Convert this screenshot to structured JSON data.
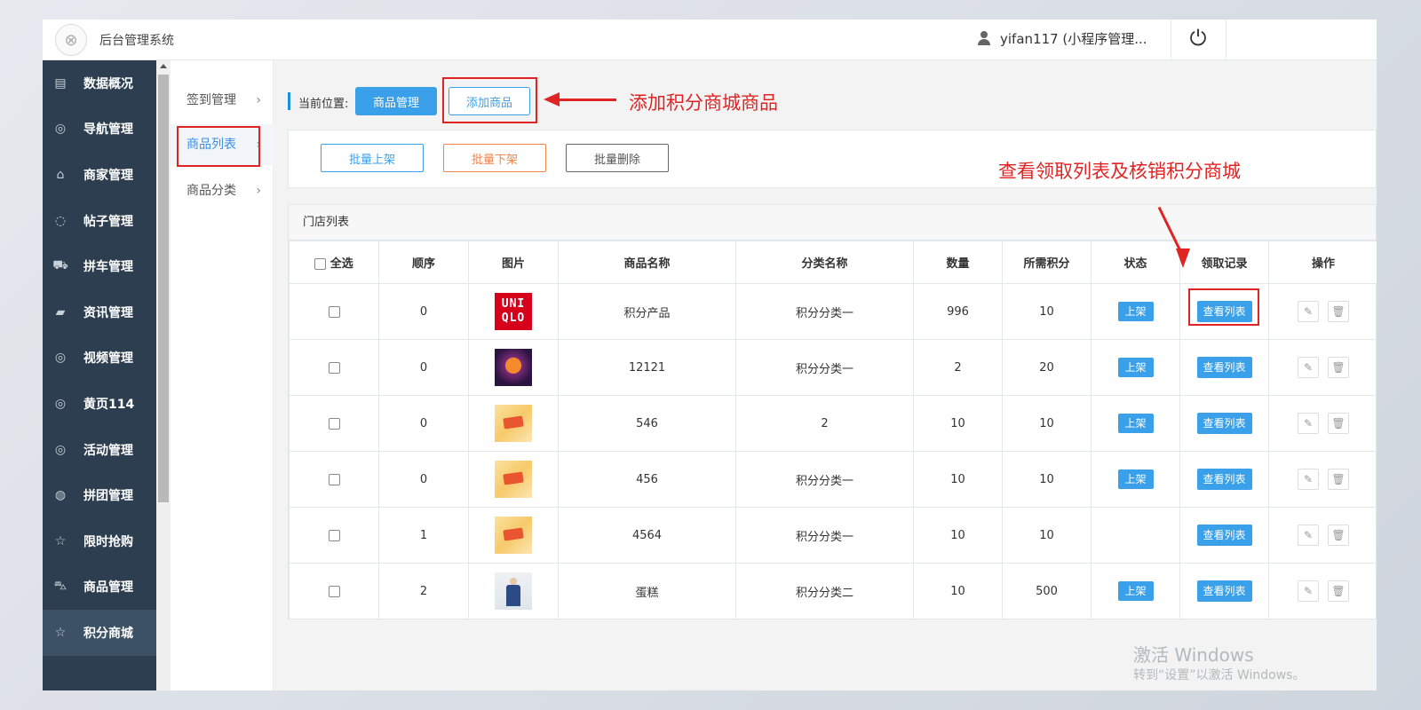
{
  "header": {
    "logo_glyph": "⊗",
    "app_title": "后台管理系统",
    "user_name": "yifan117 (小程序管理...",
    "power_glyph": "⏻"
  },
  "sidebar": {
    "items": [
      {
        "icon": "dashboard-icon",
        "glyph": "▤",
        "label": "数据概况"
      },
      {
        "icon": "compass-icon",
        "glyph": "◎",
        "label": "导航管理"
      },
      {
        "icon": "bank-icon",
        "glyph": "⌂",
        "label": "商家管理"
      },
      {
        "icon": "comment-icon",
        "glyph": "◌",
        "label": "帖子管理"
      },
      {
        "icon": "car-icon",
        "glyph": "⛟",
        "label": "拼车管理"
      },
      {
        "icon": "book-icon",
        "glyph": "▰",
        "label": "资讯管理"
      },
      {
        "icon": "video-icon",
        "glyph": "◎",
        "label": "视频管理"
      },
      {
        "icon": "compass-icon",
        "glyph": "◎",
        "label": "黄页114"
      },
      {
        "icon": "compass-icon",
        "glyph": "◎",
        "label": "活动管理"
      },
      {
        "icon": "lifebuoy-icon",
        "glyph": "◍",
        "label": "拼团管理"
      },
      {
        "icon": "star-icon",
        "glyph": "☆",
        "label": "限时抢购"
      },
      {
        "icon": "cart-icon",
        "glyph": "⛍",
        "label": "商品管理"
      },
      {
        "icon": "star-icon",
        "glyph": "☆",
        "label": "积分商城"
      }
    ]
  },
  "submenu": {
    "items": [
      {
        "label": "签到管理",
        "chevron": "›"
      },
      {
        "label": "商品列表",
        "chevron": "›"
      },
      {
        "label": "商品分类",
        "chevron": "›"
      }
    ]
  },
  "breadcrumb": {
    "label": "当前位置:",
    "current": "商品管理",
    "add_button": "添加商品"
  },
  "annotations": {
    "add_note": "添加积分商城商品",
    "view_note": "查看领取列表及核销积分商城"
  },
  "toolbar": {
    "batch_on": "批量上架",
    "batch_off": "批量下架",
    "batch_delete": "批量删除"
  },
  "table": {
    "title": "门店列表",
    "headers": {
      "select_all": "全选",
      "order": "顺序",
      "image": "图片",
      "name": "商品名称",
      "category": "分类名称",
      "quantity": "数量",
      "points": "所需积分",
      "status": "状态",
      "records": "领取记录",
      "actions": "操作"
    },
    "rows": [
      {
        "order": "0",
        "image": "uniqlo",
        "image_text": "UNI QLO",
        "name": "积分产品",
        "category": "积分分类一",
        "quantity": "996",
        "points": "10",
        "status": "上架",
        "view": "查看列表"
      },
      {
        "order": "0",
        "image": "promo-dark",
        "image_text": "",
        "name": "12121",
        "category": "积分分类一",
        "quantity": "2",
        "points": "20",
        "status": "上架",
        "view": "查看列表"
      },
      {
        "order": "0",
        "image": "promo-yellow",
        "image_text": "",
        "name": "546",
        "category": "2",
        "quantity": "10",
        "points": "10",
        "status": "上架",
        "view": "查看列表"
      },
      {
        "order": "0",
        "image": "promo-yellow",
        "image_text": "",
        "name": "456",
        "category": "积分分类一",
        "quantity": "10",
        "points": "10",
        "status": "上架",
        "view": "查看列表"
      },
      {
        "order": "1",
        "image": "promo-yellow",
        "image_text": "",
        "name": "4564",
        "category": "积分分类一",
        "quantity": "10",
        "points": "10",
        "status": "",
        "view": "查看列表"
      },
      {
        "order": "2",
        "image": "photo",
        "image_text": "",
        "name": "蛋糕",
        "category": "积分分类二",
        "quantity": "10",
        "points": "500",
        "status": "上架",
        "view": "查看列表"
      }
    ],
    "edit_glyph": "✎",
    "delete_glyph": "🗑"
  },
  "watermark": {
    "line1": "激活 Windows",
    "line2": "转到“设置”以激活 Windows。"
  },
  "colors": {
    "sidebar_bg": "#2c3e50",
    "accent": "#3aa0ea",
    "annotation": "#e02424"
  }
}
